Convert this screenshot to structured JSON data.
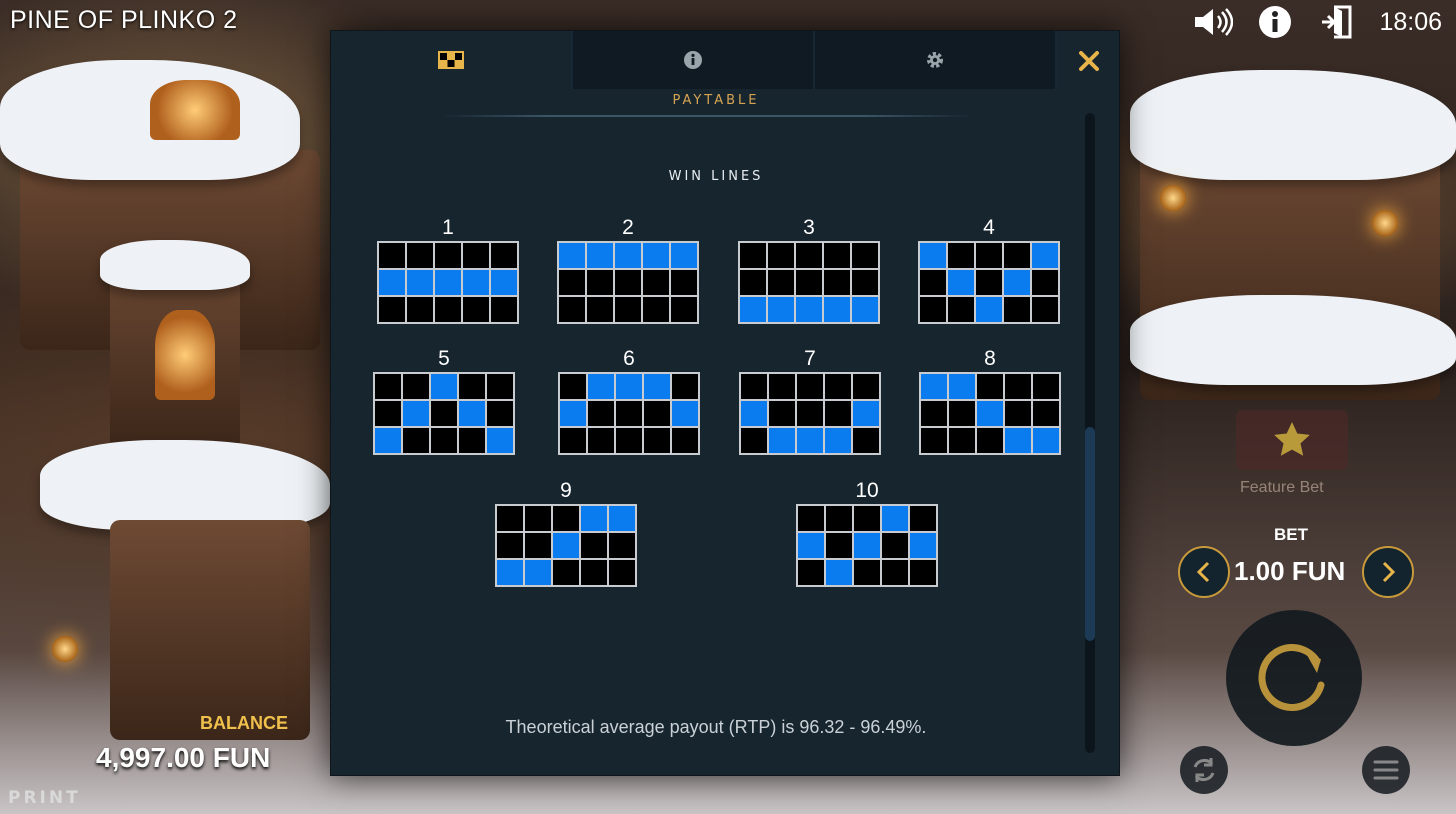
{
  "game": {
    "title": "PINE OF PLINKO 2"
  },
  "status": {
    "time": "18:06"
  },
  "top_icons": [
    "speaker-icon",
    "info-icon",
    "exit-icon"
  ],
  "modal": {
    "tabs": [
      {
        "icon": "paytable-icon",
        "active": true
      },
      {
        "icon": "info-icon",
        "active": false
      },
      {
        "icon": "gear-icon",
        "active": false
      }
    ],
    "close_icon": "close-icon",
    "section_title": "PAYTABLE",
    "subheading": "WIN LINES",
    "win_lines": [
      {
        "number": "1",
        "pattern": [
          [
            0,
            0,
            0,
            0,
            0
          ],
          [
            1,
            1,
            1,
            1,
            1
          ],
          [
            0,
            0,
            0,
            0,
            0
          ]
        ]
      },
      {
        "number": "2",
        "pattern": [
          [
            1,
            1,
            1,
            1,
            1
          ],
          [
            0,
            0,
            0,
            0,
            0
          ],
          [
            0,
            0,
            0,
            0,
            0
          ]
        ]
      },
      {
        "number": "3",
        "pattern": [
          [
            0,
            0,
            0,
            0,
            0
          ],
          [
            0,
            0,
            0,
            0,
            0
          ],
          [
            1,
            1,
            1,
            1,
            1
          ]
        ]
      },
      {
        "number": "4",
        "pattern": [
          [
            1,
            0,
            0,
            0,
            1
          ],
          [
            0,
            1,
            0,
            1,
            0
          ],
          [
            0,
            0,
            1,
            0,
            0
          ]
        ]
      },
      {
        "number": "5",
        "pattern": [
          [
            0,
            0,
            1,
            0,
            0
          ],
          [
            0,
            1,
            0,
            1,
            0
          ],
          [
            1,
            0,
            0,
            0,
            1
          ]
        ]
      },
      {
        "number": "6",
        "pattern": [
          [
            0,
            1,
            1,
            1,
            0
          ],
          [
            1,
            0,
            0,
            0,
            1
          ],
          [
            0,
            0,
            0,
            0,
            0
          ]
        ]
      },
      {
        "number": "7",
        "pattern": [
          [
            0,
            0,
            0,
            0,
            0
          ],
          [
            1,
            0,
            0,
            0,
            1
          ],
          [
            0,
            1,
            1,
            1,
            0
          ]
        ]
      },
      {
        "number": "8",
        "pattern": [
          [
            1,
            1,
            0,
            0,
            0
          ],
          [
            0,
            0,
            1,
            0,
            0
          ],
          [
            0,
            0,
            0,
            1,
            1
          ]
        ]
      },
      {
        "number": "9",
        "pattern": [
          [
            0,
            0,
            0,
            1,
            1
          ],
          [
            0,
            0,
            1,
            0,
            0
          ],
          [
            1,
            1,
            0,
            0,
            0
          ]
        ]
      },
      {
        "number": "10",
        "pattern": [
          [
            0,
            0,
            0,
            1,
            0
          ],
          [
            1,
            0,
            1,
            0,
            1
          ],
          [
            0,
            1,
            0,
            0,
            0
          ]
        ]
      }
    ],
    "rtp_text": "Theoretical average payout (RTP) is 96.32 - 96.49%."
  },
  "balance": {
    "label": "BALANCE",
    "value": "4,997.00 FUN"
  },
  "bet": {
    "feature_label": "Feature Bet",
    "label": "BET",
    "value": "1.00 FUN"
  },
  "brand": "PRINT",
  "colors": {
    "line_on": "#0b7cf0",
    "accent": "#e8b54a"
  }
}
